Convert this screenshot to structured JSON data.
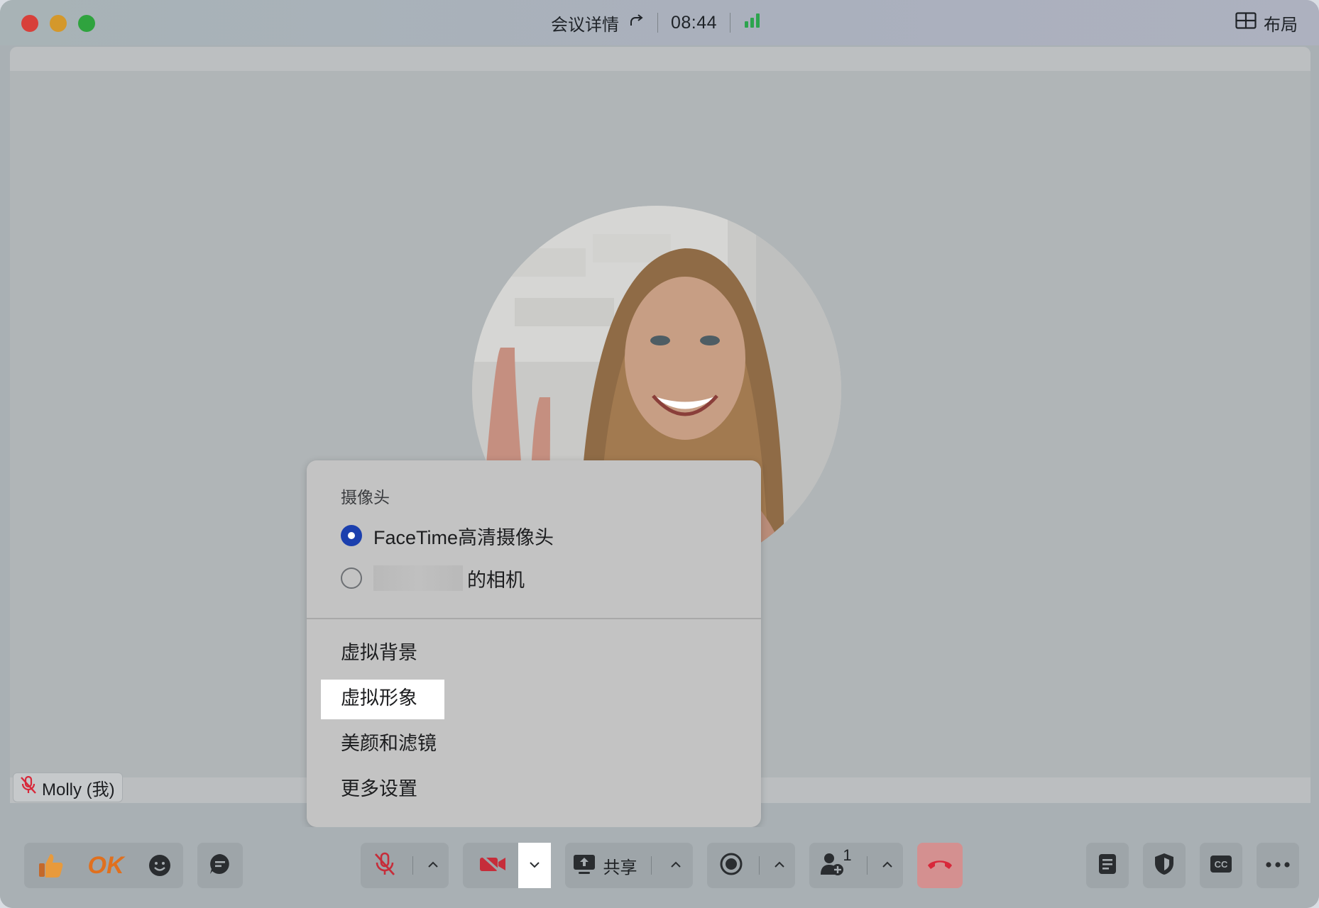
{
  "titlebar": {
    "meeting_detail_label": "会议详情",
    "timer": "08:44",
    "layout_label": "布局",
    "signal_color": "#2da44e",
    "icons": [
      "share-arrow-icon",
      "signal-bars-icon",
      "layout-grid-icon"
    ]
  },
  "participant": {
    "name": "Molly (我)",
    "mic_state_icon": "mic-muted-icon"
  },
  "camera_menu": {
    "section_title": "摄像头",
    "options": [
      {
        "label": "FaceTime高清摄像头",
        "selected": true
      },
      {
        "label": "的相机",
        "selected": false
      }
    ],
    "items": [
      "虚拟背景",
      "虚拟形象",
      "美颜和滤镜",
      "更多设置"
    ],
    "highlighted_item": "虚拟形象",
    "accent_color": "#1b3fae"
  },
  "toolbar": {
    "reactions": [
      "thumbs-up-icon",
      "OK",
      "emoji-icon"
    ],
    "ok_label": "OK",
    "share_label": "共享",
    "participant_count": "1",
    "leave_color": "#d49090",
    "leave_icon_color": "#d8283a",
    "icons": [
      "chat-icon",
      "mic-muted-icon",
      "camera-off-icon",
      "chevron-down-icon",
      "screen-share-icon",
      "record-icon",
      "add-participant-icon",
      "hang-up-icon",
      "notes-icon",
      "security-shield-icon",
      "captions-cc-icon",
      "more-dots-icon"
    ]
  }
}
